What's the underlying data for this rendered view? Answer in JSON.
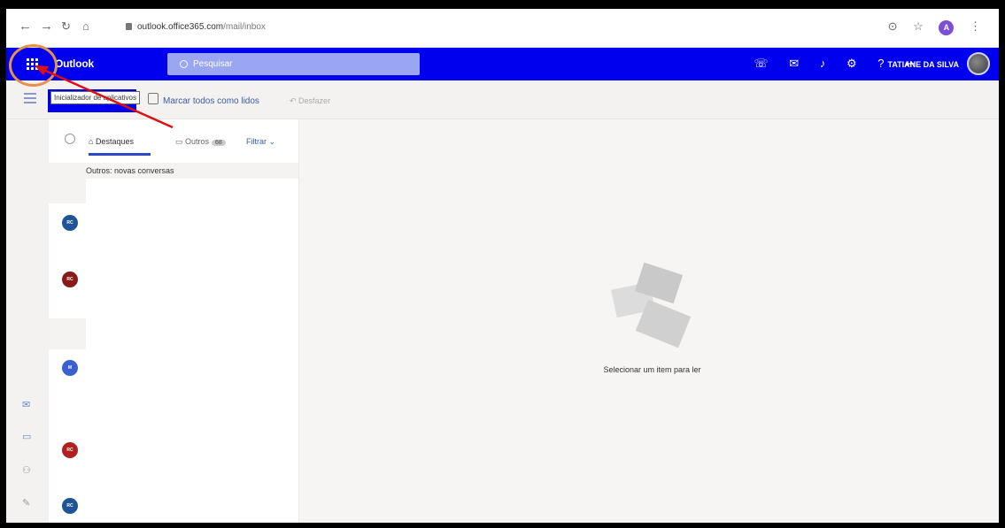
{
  "browser": {
    "url_host": "outlook.office365.com",
    "url_path": "/mail/inbox",
    "profile_initial": "A"
  },
  "header": {
    "brand": "Outlook",
    "search_placeholder": "Pesquisar",
    "user_name": "TATIANE DA SILVA"
  },
  "toolbar": {
    "tooltip": "Inicializador de aplicativos",
    "mark_all_read": "Marcar todos como lidos",
    "undo": "Desfazer"
  },
  "list": {
    "tab_focused": "Destaques",
    "tab_other": "Outros",
    "tab_other_badge": "68",
    "filter": "Filtrar",
    "section_header": "Outros: novas conversas",
    "avatars": [
      {
        "initials": "RC",
        "color": "#1f5594"
      },
      {
        "initials": "RC",
        "color": "#8a1a1a"
      },
      {
        "initials": "M",
        "color": "#3a5fd0"
      },
      {
        "initials": "RC",
        "color": "#b02020"
      },
      {
        "initials": "RC",
        "color": "#1f5594"
      }
    ]
  },
  "reading_pane": {
    "empty_message": "Selecionar um item para ler"
  },
  "colors": {
    "header_blue": "#0000ee",
    "annotation_red": "#e01010",
    "annotation_orange": "#e3914b"
  }
}
